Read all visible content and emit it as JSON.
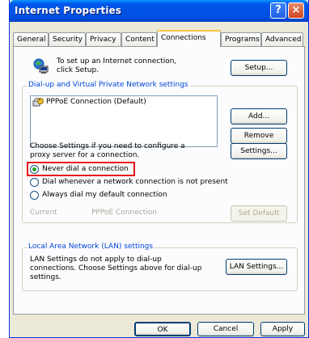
{
  "window": {
    "title": "Internet Properties",
    "help_glyph": "?",
    "close_glyph": "×"
  },
  "tabs": [
    "General",
    "Security",
    "Privacy",
    "Content",
    "Connections",
    "Programs",
    "Advanced"
  ],
  "active_tab": "Connections",
  "setup": {
    "text": "To set up an Internet connection, click Setup.",
    "button": "Setup..."
  },
  "dialup": {
    "legend": "Dial-up and Virtual Private Network settings",
    "connections": [
      "PPPoE Connection (Default)"
    ],
    "add_button": "Add...",
    "remove_button": "Remove",
    "settings_text": "Choose Settings if you need to configure a proxy server for a connection.",
    "settings_button": "Settings...",
    "radio_options": [
      {
        "label": "Never dial a connection",
        "selected": true
      },
      {
        "label": "Dial whenever a network connection is not present",
        "selected": false
      },
      {
        "label": "Always dial my default connection",
        "selected": false
      }
    ],
    "current_label": "Current",
    "current_value": "PPPoE Connection",
    "set_default_button": "Set Default"
  },
  "lan": {
    "legend": "Local Area Network (LAN) settings",
    "text": "LAN Settings do not apply to dial-up connections. Choose Settings above for dial-up settings.",
    "button": "LAN Settings..."
  },
  "footer": {
    "ok": "OK",
    "cancel": "Cancel",
    "apply": "Apply"
  },
  "colors": {
    "titlebar": "#0055ea",
    "highlight": "#e8141a",
    "legend": "#0046d5"
  }
}
